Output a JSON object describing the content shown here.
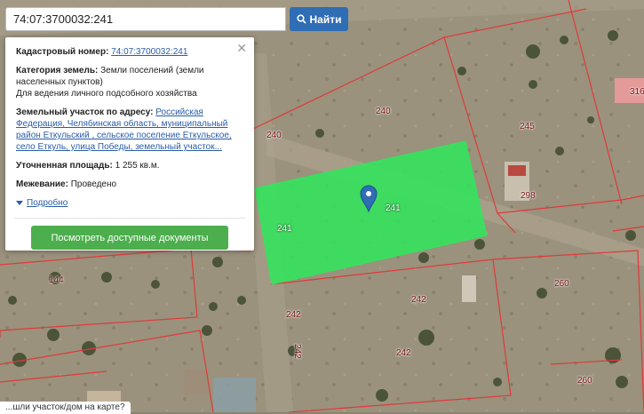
{
  "search": {
    "value": "74:07:3700032:241",
    "button_label": "Найти"
  },
  "popup": {
    "cadastral_label": "Кадастровый номер:",
    "cadastral_value": "74:07:3700032:241",
    "category_label": "Категория земель:",
    "category_value": "Земли поселений (земли населенных пунктов)",
    "use_value": "Для ведения личного подсобного хозяйства",
    "address_label": "Земельный участок по адресу:",
    "address_value": "Российская Федерация, Челябинская область, муниципальный район Еткульский , сельское поселение Еткульское, село Еткуль, улица Победы, земельный участок...",
    "area_label": "Уточненная площадь:",
    "area_value": "1 255 кв.м.",
    "survey_label": "Межевание:",
    "survey_value": "Проведено",
    "more_label": "Подробно",
    "docs_button": "Посмотреть доступные документы"
  },
  "map": {
    "plot_labels": [
      "240",
      "240",
      "245",
      "241",
      "241",
      "298",
      "144",
      "242",
      "242",
      "242",
      "242",
      "260",
      "260",
      "316"
    ],
    "selected_color": "#2ee85a",
    "boundary_color": "#e0393a"
  },
  "bottom_hint": "...шли участок/дом на карте?"
}
